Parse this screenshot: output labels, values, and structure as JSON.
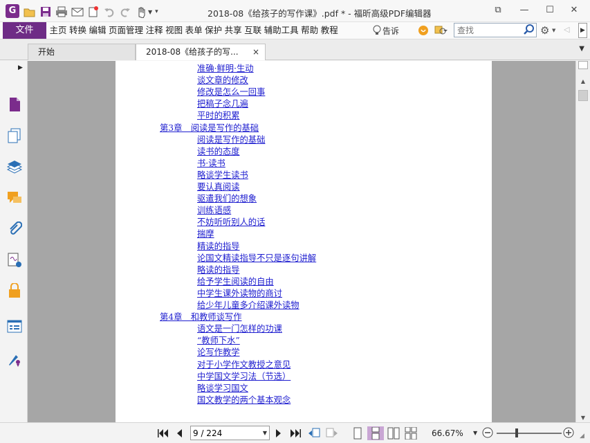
{
  "app": {
    "logo_glyph": "G",
    "title": "2018-08《给孩子的写作课》.pdf * - 福昕高级PDF编辑器"
  },
  "window_controls": {
    "restore_glyph": "⧉",
    "minimize_glyph": "—",
    "maximize_glyph": "☐",
    "close_glyph": "✕"
  },
  "menu": {
    "file_label": "文件",
    "items": [
      "主页",
      "转换",
      "编辑",
      "页面管理",
      "注释",
      "视图",
      "表单",
      "保护",
      "共享",
      "互联",
      "辅助工具",
      "帮助",
      "教程"
    ],
    "tell_me": "告诉",
    "search_placeholder": "查找"
  },
  "tabs": [
    {
      "label": "开始"
    },
    {
      "label": "2018-08《给孩子的写...",
      "close": "×"
    }
  ],
  "toc": [
    {
      "text": "准确·鲜明·生动",
      "level": 2
    },
    {
      "text": "谈文章的修改",
      "level": 2
    },
    {
      "text": "修改是怎么一回事",
      "level": 2
    },
    {
      "text": "把稿子念几遍",
      "level": 2
    },
    {
      "text": "平时的积累",
      "level": 2
    },
    {
      "text": "第3章　阅读是写作的基础",
      "level": 1
    },
    {
      "text": "阅读是写作的基础",
      "level": 2
    },
    {
      "text": "读书的态度",
      "level": 2
    },
    {
      "text": "书·读书",
      "level": 2
    },
    {
      "text": "略谈学生读书",
      "level": 2
    },
    {
      "text": "要认真阅读",
      "level": 2
    },
    {
      "text": "驱遣我们的想象",
      "level": 2
    },
    {
      "text": "训练语感",
      "level": 2
    },
    {
      "text": "不妨听听别人的话",
      "level": 2
    },
    {
      "text": "揣摩",
      "level": 2
    },
    {
      "text": "精读的指导",
      "level": 2
    },
    {
      "text": "论国文精读指导不只是逐句讲解",
      "level": 2
    },
    {
      "text": "略读的指导",
      "level": 2
    },
    {
      "text": "给予学生阅读的自由",
      "level": 2
    },
    {
      "text": "中学生课外读物的商讨",
      "level": 2
    },
    {
      "text": "给少年儿童多介绍课外读物",
      "level": 2
    },
    {
      "text": "第4章　和教师谈写作",
      "level": 1
    },
    {
      "text": "语文是一门怎样的功课",
      "level": 2
    },
    {
      "text": "“教师下水”",
      "level": 2
    },
    {
      "text": "论写作教学",
      "level": 2
    },
    {
      "text": "对于小学作文教授之意见",
      "level": 2
    },
    {
      "text": "中学国文学习法（节选）",
      "level": 2
    },
    {
      "text": "略谈学习国文",
      "level": 2
    },
    {
      "text": "国文教学的两个基本观念",
      "level": 2
    }
  ],
  "status": {
    "page_value": "9 / 224",
    "zoom": "66.67%"
  },
  "colors": {
    "accent": "#6e2c86",
    "link": "#1d1dcf",
    "doc_bg": "#a6a6a6"
  }
}
